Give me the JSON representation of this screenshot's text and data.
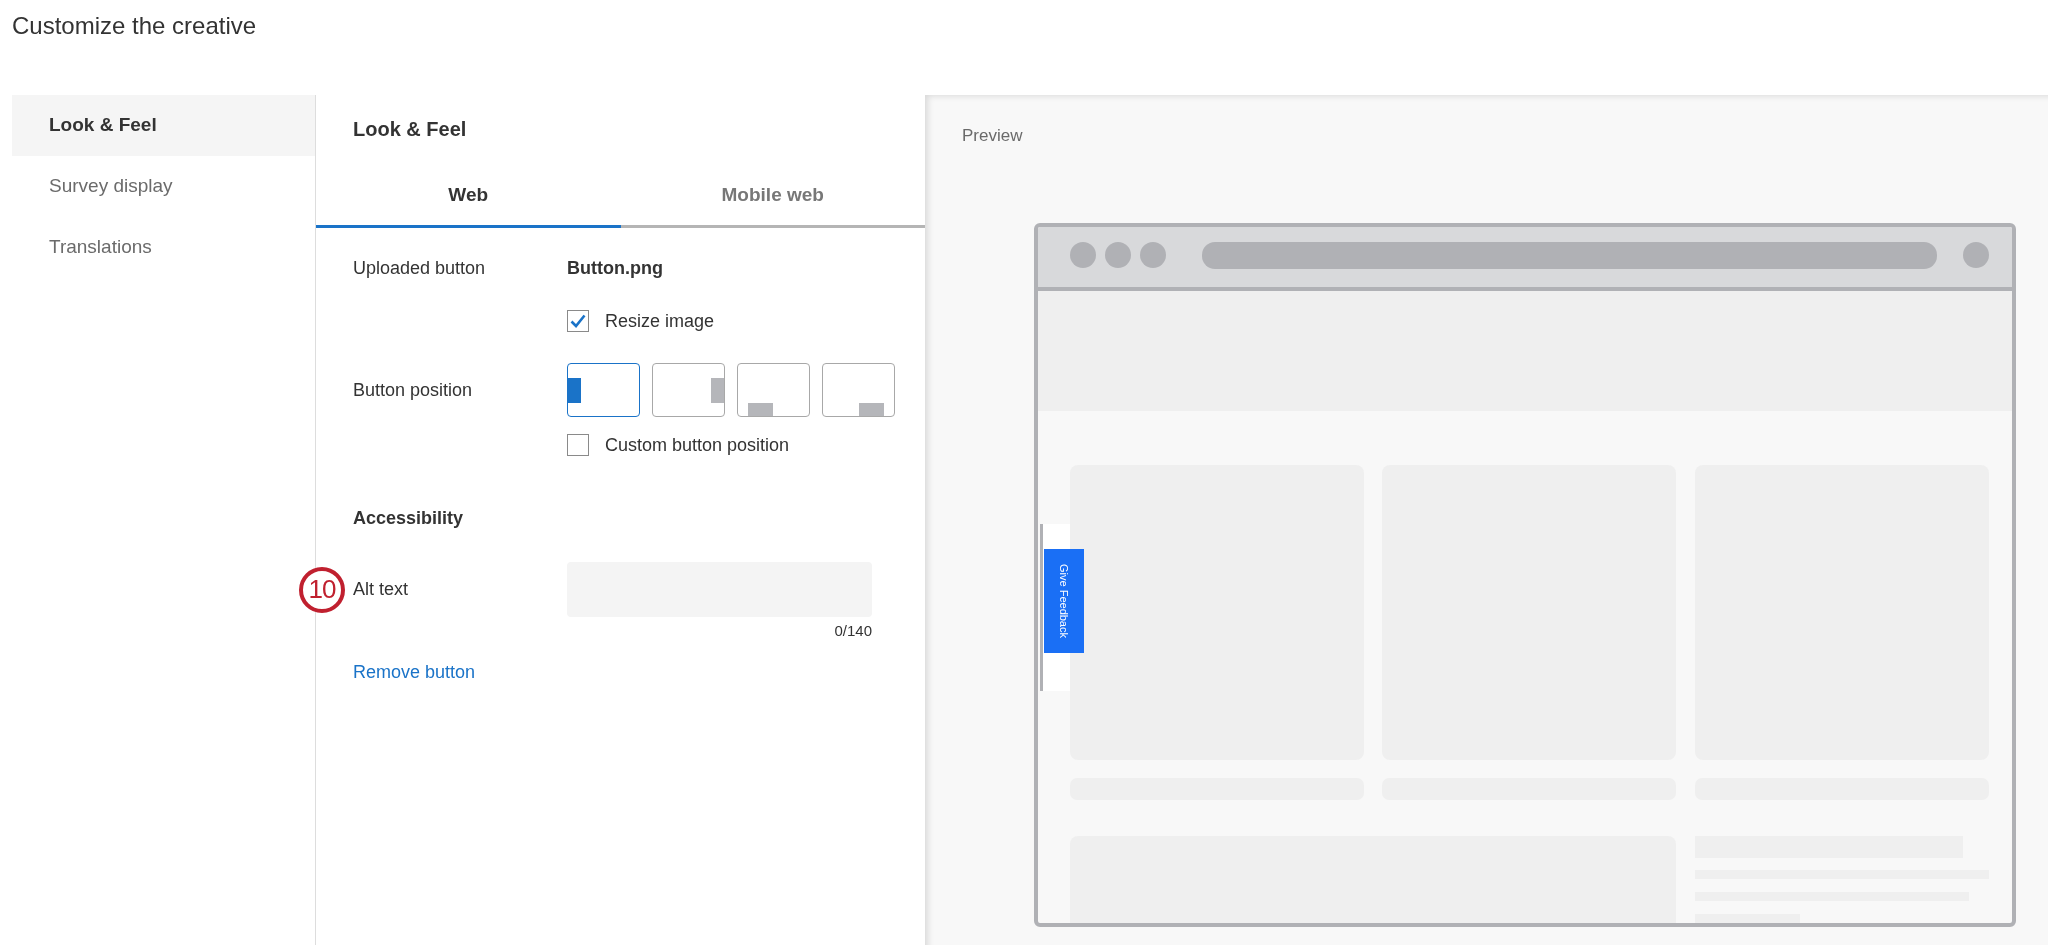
{
  "title": "Customize the creative",
  "sidebar": {
    "items": [
      {
        "label": "Look & Feel",
        "selected": true
      },
      {
        "label": "Survey display",
        "selected": false
      },
      {
        "label": "Translations",
        "selected": false
      }
    ]
  },
  "panel": {
    "heading": "Look & Feel",
    "tabs": [
      {
        "label": "Web",
        "selected": true
      },
      {
        "label": "Mobile web",
        "selected": false
      }
    ],
    "uploaded_button": {
      "label": "Uploaded button",
      "file": "Button.png"
    },
    "resize_image": {
      "label": "Resize image",
      "checked": true
    },
    "button_position": {
      "label": "Button position",
      "options": [
        {
          "kind": "left",
          "selected": true
        },
        {
          "kind": "right",
          "selected": false
        },
        {
          "kind": "bottom-left",
          "selected": false
        },
        {
          "kind": "bottom-right",
          "selected": false
        }
      ]
    },
    "custom_position": {
      "label": "Custom button position",
      "checked": false
    },
    "accessibility": {
      "heading": "Accessibility",
      "callout": "10",
      "alt_label": "Alt text",
      "counter": "0/140"
    },
    "remove_link": "Remove button"
  },
  "preview": {
    "label": "Preview",
    "feedback_button": "Give Feedback"
  }
}
